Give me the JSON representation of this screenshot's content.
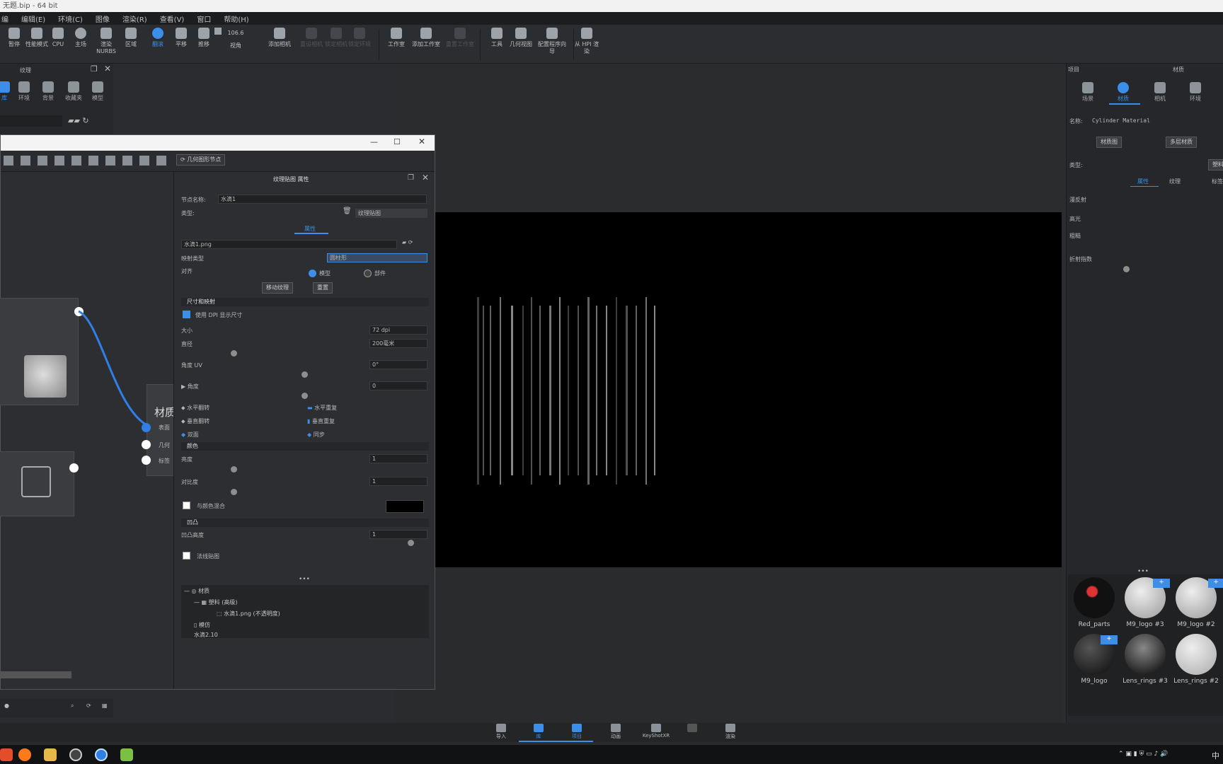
{
  "window": {
    "title": "无题.bip - 64 bit"
  },
  "menu": [
    "编",
    "编辑(E)",
    "环境(C)",
    "图像",
    "渲染(R)",
    "查看(V)",
    "窗口",
    "帮助(H)"
  ],
  "toolbar": [
    {
      "label": "暂停",
      "icon": "pause-icon"
    },
    {
      "label": "性能模式",
      "icon": "performance-icon"
    },
    {
      "label": "CPU",
      "icon": "cpu-icon"
    },
    {
      "label": "主场",
      "icon": "sphere-icon"
    },
    {
      "label": "渲染NURBS",
      "icon": "nurbs-icon"
    },
    {
      "label": "区域",
      "icon": "region-icon"
    },
    {
      "label": "翻滚",
      "icon": "tumble-icon",
      "active": true
    },
    {
      "label": "平移",
      "icon": "pan-icon"
    },
    {
      "label": "推移",
      "icon": "dolly-icon"
    },
    {
      "label": "视角",
      "icon": "camera-icon",
      "value": "106.6"
    },
    {
      "label": "添加相机",
      "icon": "add-camera-icon"
    },
    {
      "label": "重设相机",
      "icon": "reset-camera-icon",
      "dim": true
    },
    {
      "label": "锁定相机",
      "icon": "lock-camera-icon",
      "dim": true
    },
    {
      "label": "锁定环境",
      "icon": "lock-env-icon",
      "dim": true
    },
    {
      "label": "工作室",
      "icon": "studio-icon"
    },
    {
      "label": "添加工作室",
      "icon": "add-studio-icon"
    },
    {
      "label": "重置工作室",
      "icon": "reset-studio-icon",
      "dim": true
    },
    {
      "label": "工具",
      "icon": "tools-icon"
    },
    {
      "label": "几何视图",
      "icon": "geometry-view-icon"
    },
    {
      "label": "配置程序向导",
      "icon": "configurator-icon"
    },
    {
      "label": "从 HPI 渲染",
      "icon": "render-icon"
    }
  ],
  "left_panel": {
    "title": "纹理",
    "tabs": [
      "库",
      "环境",
      "背景",
      "收藏夹",
      "模型"
    ]
  },
  "material_editor": {
    "toolbar_btn": "几何图形节点",
    "node_label": "材质",
    "node_ports": [
      "表面",
      "几何",
      "标签"
    ],
    "props_title": "纹理贴图 属性",
    "node_name_label": "节点名称:",
    "node_name_value": "水滴1",
    "type_label": "类型:",
    "type_value": "纹理贴图",
    "tab": "属性",
    "file_value": "水滴1.png",
    "mapping_label": "映射类型",
    "mapping_value": "圆柱形",
    "align_label": "对齐",
    "align_opt1": "模型",
    "align_opt2": "部件",
    "btn_interactive": "移动纹理",
    "btn_reset": "重置",
    "section_size": "尺寸和映射",
    "use_dpi_label": "使用 DPI 显示尺寸",
    "size_label": "大小",
    "size_value": "72 dpi",
    "diameter_label": "直径",
    "diameter_value": "200毫米",
    "angle_label": "角度 UV",
    "angle_value": "0°",
    "angle2_label": "角度",
    "angle2_value": "0",
    "flip_h": "水平翻转",
    "repeat_h": "水平重复",
    "flip_v": "垂直翻转",
    "repeat_v": "垂直重复",
    "two_sided": "双面",
    "sync": "同步",
    "section_color": "颜色",
    "brightness_label": "亮度",
    "brightness_value": "1",
    "contrast_label": "对比度",
    "contrast_value": "1",
    "blend_label": "与颜色混合",
    "section_bump": "凹凸",
    "bump_label": "凹凸高度",
    "bump_value": "1",
    "normal_label": "法线贴图",
    "tree": [
      "材质",
      "塑料 (高级)",
      "水滴1.png (不透明度)",
      "模仿",
      "水滴2.10"
    ]
  },
  "right_panel": {
    "header_left": "项目",
    "header_right": "材质",
    "tabs": [
      "场景",
      "材质",
      "相机",
      "环境"
    ],
    "name_label": "名称:",
    "name_value": "Cylinder Material",
    "btn_graph": "材质图",
    "btn_multi": "多层材质",
    "type_label": "类型:",
    "type_btn": "塑料",
    "subtabs": [
      "属性",
      "纹理",
      "标签"
    ],
    "diffuse": "漫反射",
    "highlight": "高光",
    "roughness": "粗糙",
    "refraction": "折射指数",
    "thumbs": [
      {
        "label": "Red_parts"
      },
      {
        "label": "M9_logo #3"
      },
      {
        "label": "M9_logo #2"
      },
      {
        "label": "M9_logo"
      },
      {
        "label": "Lens_rings #3"
      },
      {
        "label": "Lens_rings #2"
      }
    ]
  },
  "bottom_bar": [
    {
      "label": "导入",
      "icon": "import-icon"
    },
    {
      "label": "库",
      "icon": "library-icon",
      "active": true
    },
    {
      "label": "项目",
      "icon": "project-icon",
      "active": true
    },
    {
      "label": "动画",
      "icon": "animation-icon"
    },
    {
      "label": "KeyShotXR",
      "icon": "keyshotxr-icon"
    },
    {
      "label": "",
      "icon": "blank-icon"
    },
    {
      "label": "渲染",
      "icon": "render-icon"
    }
  ],
  "taskbar": {
    "ime": "中"
  },
  "colors": {
    "accent": "#3b8fe8",
    "bg": "#2b2d30",
    "viewport": "#000000"
  }
}
